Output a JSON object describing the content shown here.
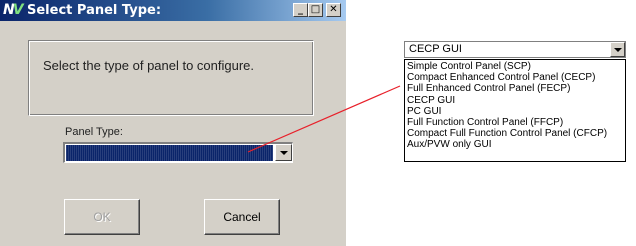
{
  "window": {
    "title": "Select Panel Type:",
    "app_icon_text": "N",
    "app_icon_text2": "V",
    "minimize_glyph": "_",
    "maximize_glyph": "□",
    "close_glyph": "✕"
  },
  "prompt": "Select the type of panel to configure.",
  "panel_type": {
    "label": "Panel Type:",
    "selected_value": ""
  },
  "buttons": {
    "ok": "OK",
    "cancel": "Cancel"
  },
  "dropdown_example": {
    "selected": "CECP GUI",
    "options": [
      "Simple Control Panel (SCP)",
      "Compact Enhanced Control Panel (CECP)",
      "Full Enhanced Control Panel (FECP)",
      "CECP GUI",
      "PC GUI",
      "Full Function Control Panel (FFCP)",
      "Compact Full Function Control Panel (CFCP)",
      "Aux/PVW only GUI"
    ]
  },
  "colors": {
    "titlebar": "#0a246a",
    "selection": "#0a246a",
    "callout_line": "#e8202a",
    "face": "#d4d0c8"
  }
}
